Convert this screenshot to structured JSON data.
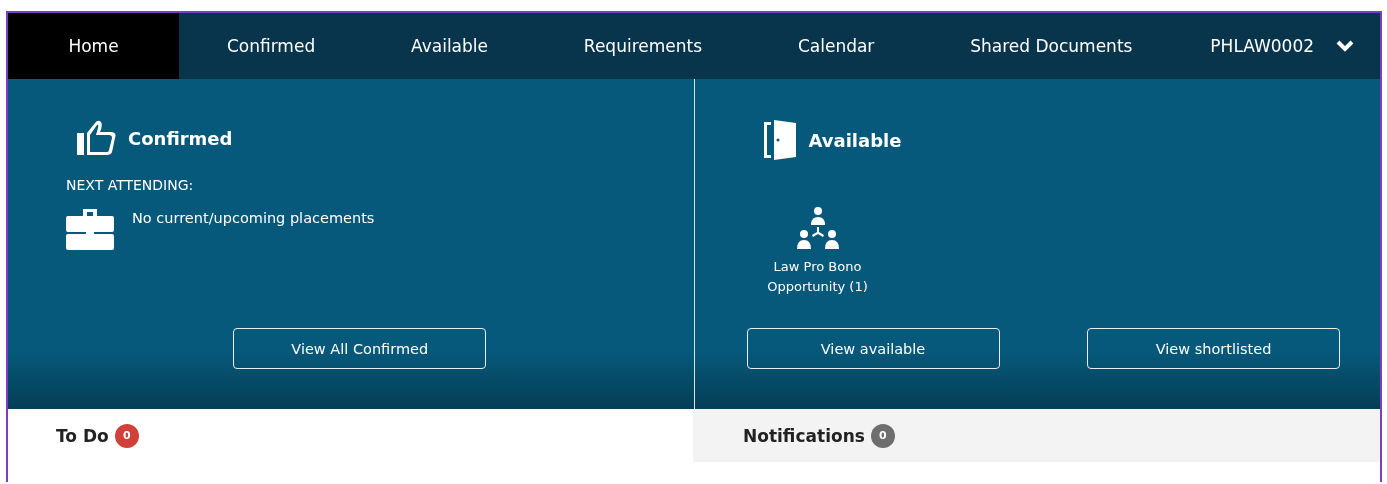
{
  "nav": {
    "items": [
      {
        "label": "Home",
        "selected": true
      },
      {
        "label": "Confirmed",
        "selected": false
      },
      {
        "label": "Available",
        "selected": false
      },
      {
        "label": "Requirements",
        "selected": false
      },
      {
        "label": "Calendar",
        "selected": false
      },
      {
        "label": "Shared Documents",
        "selected": false
      }
    ],
    "user": {
      "label": "PHLAW0002"
    }
  },
  "confirmed": {
    "title": "Confirmed",
    "subheading": "NEXT ATTENDING:",
    "message": "No current/upcoming placements",
    "button": "View All Confirmed"
  },
  "available": {
    "title": "Available",
    "opportunities": [
      {
        "label": "Law Pro Bono Opportunity (1)"
      }
    ],
    "buttons": [
      "View available",
      "View shortlisted"
    ]
  },
  "todo": {
    "title": "To Do",
    "count": "0",
    "color": "#d2403a"
  },
  "notifications": {
    "title": "Notifications",
    "count": "0",
    "color": "#6e6e6e"
  }
}
